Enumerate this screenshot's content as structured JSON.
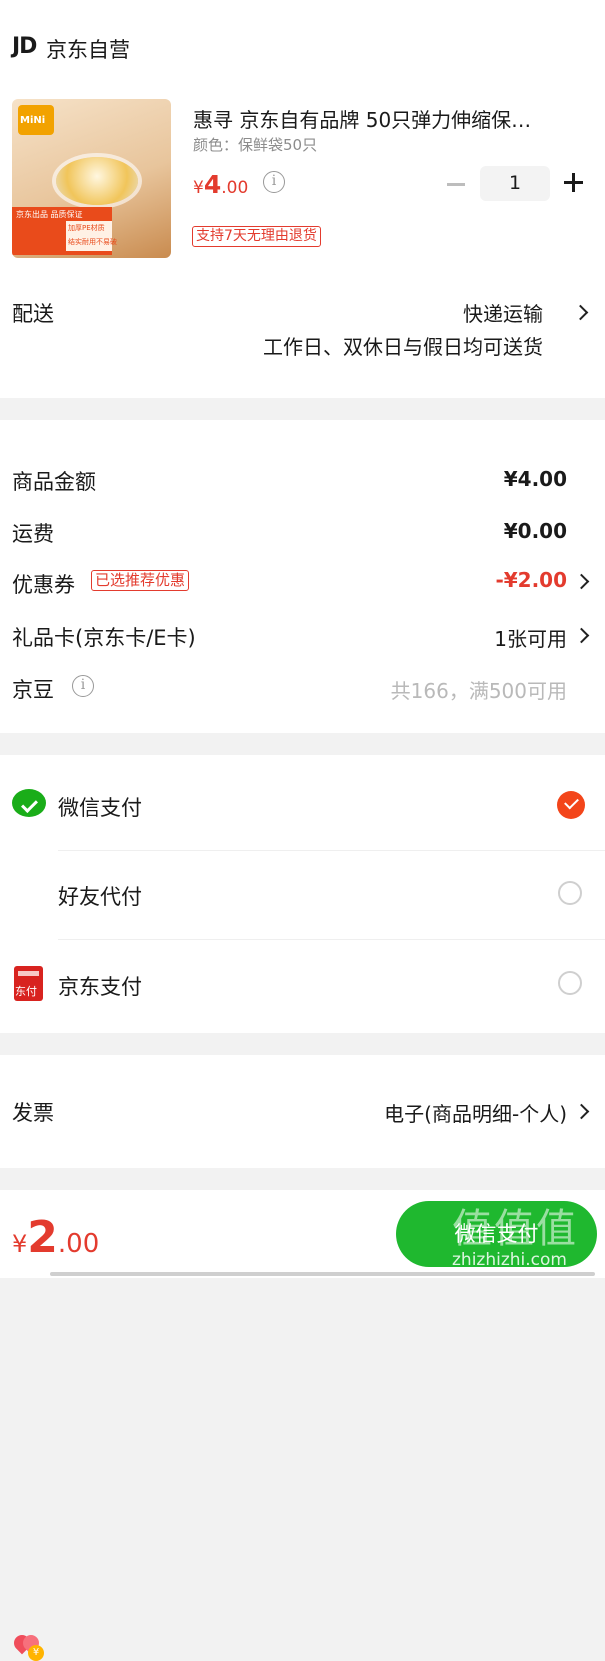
{
  "shop": {
    "logo": "JD",
    "name": "京东自营"
  },
  "product": {
    "title": "惠寻 京东自有品牌  50只弹力伸缩保…",
    "spec": "颜色：保鲜袋50只",
    "price_symbol": "¥",
    "price_int": "4",
    "price_dec": ".00",
    "quantity": "1",
    "return_tag": "支持7天无理由退货",
    "image": {
      "badge": "MiNi",
      "box_line1": "京东出品",
      "box_line2": "品质保证",
      "feat1": "加厚PE材质",
      "feat2": "结实耐用不易破"
    }
  },
  "delivery": {
    "label": "配送",
    "method": "快递运输",
    "note": "工作日、双休日与假日均可送货"
  },
  "amounts": {
    "goods_label": "商品金额",
    "goods_value": "¥4.00",
    "shipping_label": "运费",
    "shipping_value": "¥0.00",
    "coupon_label": "优惠券",
    "coupon_tag": "已选推荐优惠",
    "coupon_value": "-¥2.00",
    "giftcard_label": "礼品卡(京东卡/E卡)",
    "giftcard_value": "1张可用",
    "jingdou_label": "京豆",
    "jingdou_value": "共166，满500可用"
  },
  "payment": {
    "wechat": "微信支付",
    "friend": "好友代付",
    "jdpay": "京东支付",
    "selected": "wechat",
    "jdpay_icon_text": "东付"
  },
  "invoice": {
    "label": "发票",
    "value": "电子(商品明细-个人)"
  },
  "footer": {
    "total_symbol": "¥",
    "total_int": "2",
    "total_dec": ".00",
    "pay_button": "微信支付",
    "watermark": "值值值",
    "watermark_url": "zhizhizhi.com"
  },
  "colors": {
    "accent": "#e33b2e",
    "wechat": "#1aad19",
    "primary_button": "#1fb82f"
  }
}
